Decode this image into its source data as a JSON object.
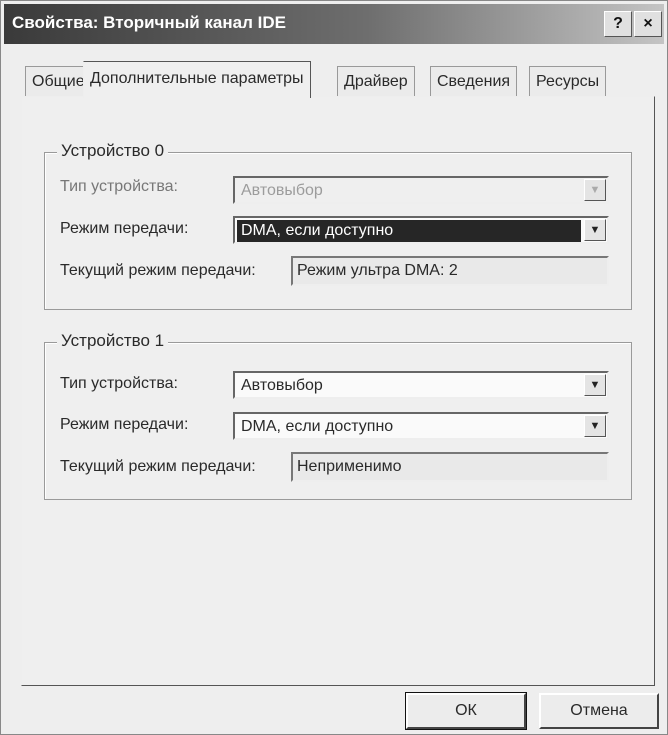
{
  "window": {
    "title": "Свойства: Вторичный канал IDE",
    "help_label": "?",
    "close_label": "×"
  },
  "tabs": [
    {
      "label": "Общие"
    },
    {
      "label": "Дополнительные параметры"
    },
    {
      "label": "Драйвер"
    },
    {
      "label": "Сведения"
    },
    {
      "label": "Ресурсы"
    }
  ],
  "device0": {
    "legend": "Устройство 0",
    "type_label": "Тип устройства:",
    "type_value": "Автовыбор",
    "mode_label": "Режим передачи:",
    "mode_value": "DMA, если доступно",
    "current_label": "Текущий режим передачи:",
    "current_value": "Режим ультра DMA: 2"
  },
  "device1": {
    "legend": "Устройство 1",
    "type_label": "Тип устройства:",
    "type_value": "Автовыбор",
    "mode_label": "Режим передачи:",
    "mode_value": "DMA, если доступно",
    "current_label": "Текущий режим передачи:",
    "current_value": "Неприменимо"
  },
  "buttons": {
    "ok": "ОК",
    "cancel": "Отмена"
  }
}
